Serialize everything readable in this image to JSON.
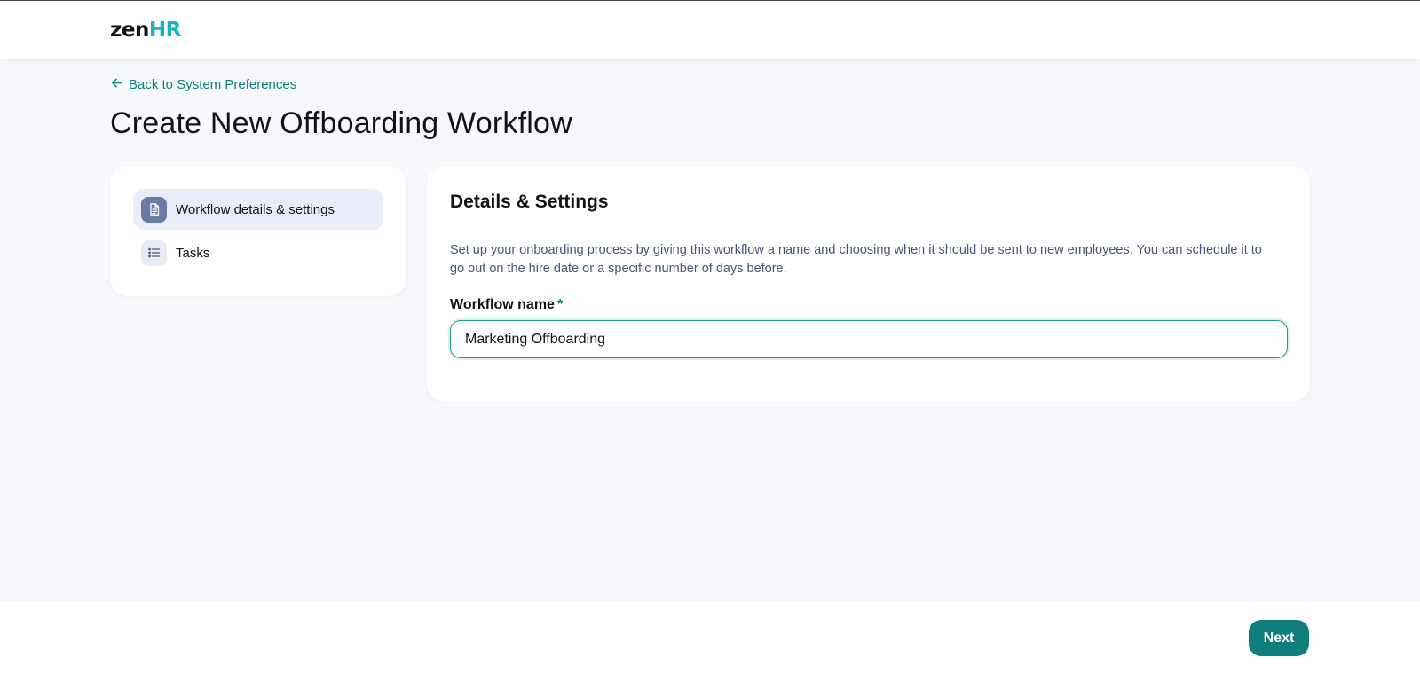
{
  "header": {
    "logo_zen": "zen",
    "logo_hr": "HR"
  },
  "nav": {
    "back_label": "Back to System Preferences"
  },
  "page": {
    "title": "Create New Offboarding Workflow"
  },
  "steps": [
    {
      "label": "Workflow details & settings",
      "icon": "document-icon",
      "active": true
    },
    {
      "label": "Tasks",
      "icon": "list-icon",
      "active": false
    }
  ],
  "details": {
    "title": "Details & Settings",
    "description": "Set up your onboarding process by giving this workflow a name and choosing when it should be sent to new employees. You can schedule it to go out on the hire date or a specific number of days before.",
    "field_label": "Workflow name",
    "required_marker": "*",
    "workflow_name_value": "Marketing Offboarding"
  },
  "footer": {
    "next_label": "Next"
  },
  "colors": {
    "accent": "#0e7f7a",
    "logo_hr": "#12b5c0",
    "active_step_bg": "#e8edf9",
    "active_step_icon_bg": "#6a7aa3",
    "page_bg": "#f7f8fc"
  }
}
